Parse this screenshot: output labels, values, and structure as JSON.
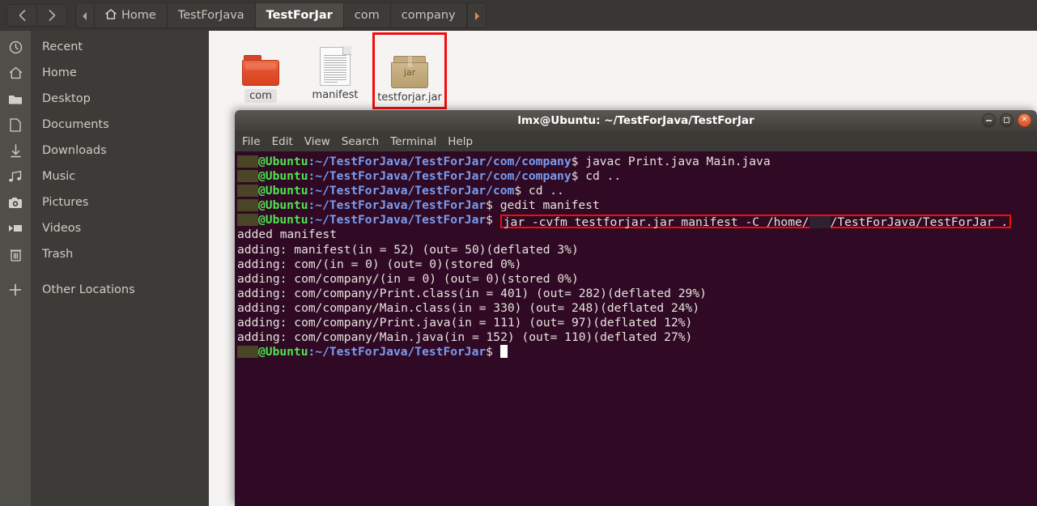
{
  "window": {
    "nav": {
      "back_icon": "chevron-left-icon",
      "forward_icon": "chevron-right-icon"
    },
    "breadcrumbs": {
      "left_arrow": "◀",
      "right_arrow": "▶",
      "items": [
        {
          "label": "Home",
          "icon": "home-icon",
          "active": false
        },
        {
          "label": "TestForJava",
          "active": false
        },
        {
          "label": "TestForJar",
          "active": true
        },
        {
          "label": "com",
          "active": false
        },
        {
          "label": "company",
          "active": false
        }
      ]
    }
  },
  "sidebar": {
    "items": [
      {
        "label": "Recent",
        "icon": "clock-icon"
      },
      {
        "label": "Home",
        "icon": "home-icon"
      },
      {
        "label": "Desktop",
        "icon": "folder-icon"
      },
      {
        "label": "Documents",
        "icon": "document-icon"
      },
      {
        "label": "Downloads",
        "icon": "download-icon"
      },
      {
        "label": "Music",
        "icon": "music-note-icon"
      },
      {
        "label": "Pictures",
        "icon": "camera-icon"
      },
      {
        "label": "Videos",
        "icon": "film-icon"
      },
      {
        "label": "Trash",
        "icon": "trash-icon"
      },
      {
        "label": "Other Locations",
        "icon": "plus-icon"
      }
    ]
  },
  "files": [
    {
      "name": "com",
      "type": "folder",
      "selected": true,
      "highlighted": false
    },
    {
      "name": "manifest",
      "type": "document",
      "selected": false,
      "highlighted": false
    },
    {
      "name": "testforjar.jar",
      "type": "jar",
      "icon_text": "jar",
      "selected": false,
      "highlighted": true
    }
  ],
  "terminal": {
    "title": "lmx@Ubuntu: ~/TestForJava/TestForJar",
    "menu": [
      "File",
      "Edit",
      "View",
      "Search",
      "Terminal",
      "Help"
    ],
    "window_buttons": {
      "minimize": "minimize-icon",
      "maximize": "maximize-icon",
      "close": "close-icon"
    },
    "lines": [
      {
        "type": "prompt",
        "redacted_user": true,
        "host": "@Ubuntu",
        "path": ":~/TestForJava/TestForJar/com/company",
        "sigil": "$ ",
        "command": "javac Print.java Main.java",
        "boxed": false
      },
      {
        "type": "prompt",
        "redacted_user": true,
        "host": "@Ubuntu",
        "path": ":~/TestForJava/TestForJar/com/company",
        "sigil": "$ ",
        "command": "cd ..",
        "boxed": false
      },
      {
        "type": "prompt",
        "redacted_user": true,
        "host": "@Ubuntu",
        "path": ":~/TestForJava/TestForJar/com",
        "sigil": "$ ",
        "command": "cd ..",
        "boxed": false
      },
      {
        "type": "prompt",
        "redacted_user": true,
        "host": "@Ubuntu",
        "path": ":~/TestForJava/TestForJar",
        "sigil": "$ ",
        "command": "gedit manifest",
        "boxed": false
      },
      {
        "type": "prompt-boxed",
        "redacted_user": true,
        "host": "@Ubuntu",
        "path": ":~/TestForJava/TestForJar",
        "sigil": "$ ",
        "command_pre": "jar -cvfm testforjar.jar manifest -C /home/",
        "command_post": "/TestForJava/TestForJar .",
        "boxed": true
      },
      {
        "type": "out",
        "text": "added manifest"
      },
      {
        "type": "out",
        "text": "adding: manifest(in = 52) (out= 50)(deflated 3%)"
      },
      {
        "type": "out",
        "text": "adding: com/(in = 0) (out= 0)(stored 0%)"
      },
      {
        "type": "out",
        "text": "adding: com/company/(in = 0) (out= 0)(stored 0%)"
      },
      {
        "type": "out",
        "text": "adding: com/company/Print.class(in = 401) (out= 282)(deflated 29%)"
      },
      {
        "type": "out",
        "text": "adding: com/company/Main.class(in = 330) (out= 248)(deflated 24%)"
      },
      {
        "type": "out",
        "text": "adding: com/company/Print.java(in = 111) (out= 97)(deflated 12%)"
      },
      {
        "type": "out",
        "text": "adding: com/company/Main.java(in = 152) (out= 110)(deflated 27%)"
      },
      {
        "type": "prompt-cursor",
        "redacted_user": true,
        "host": "@Ubuntu",
        "path": ":~/TestForJava/TestForJar",
        "sigil": "$ ",
        "command": "",
        "boxed": false
      }
    ]
  },
  "colors": {
    "terminal_bg": "#300a24",
    "prompt_green": "#4ee44e",
    "prompt_blue": "#7a9cf0",
    "annotation_red": "#f20d0d",
    "folder_orange": "#e2502c",
    "header_bg": "#393734",
    "sidebar_bg": "#3c3b37"
  }
}
